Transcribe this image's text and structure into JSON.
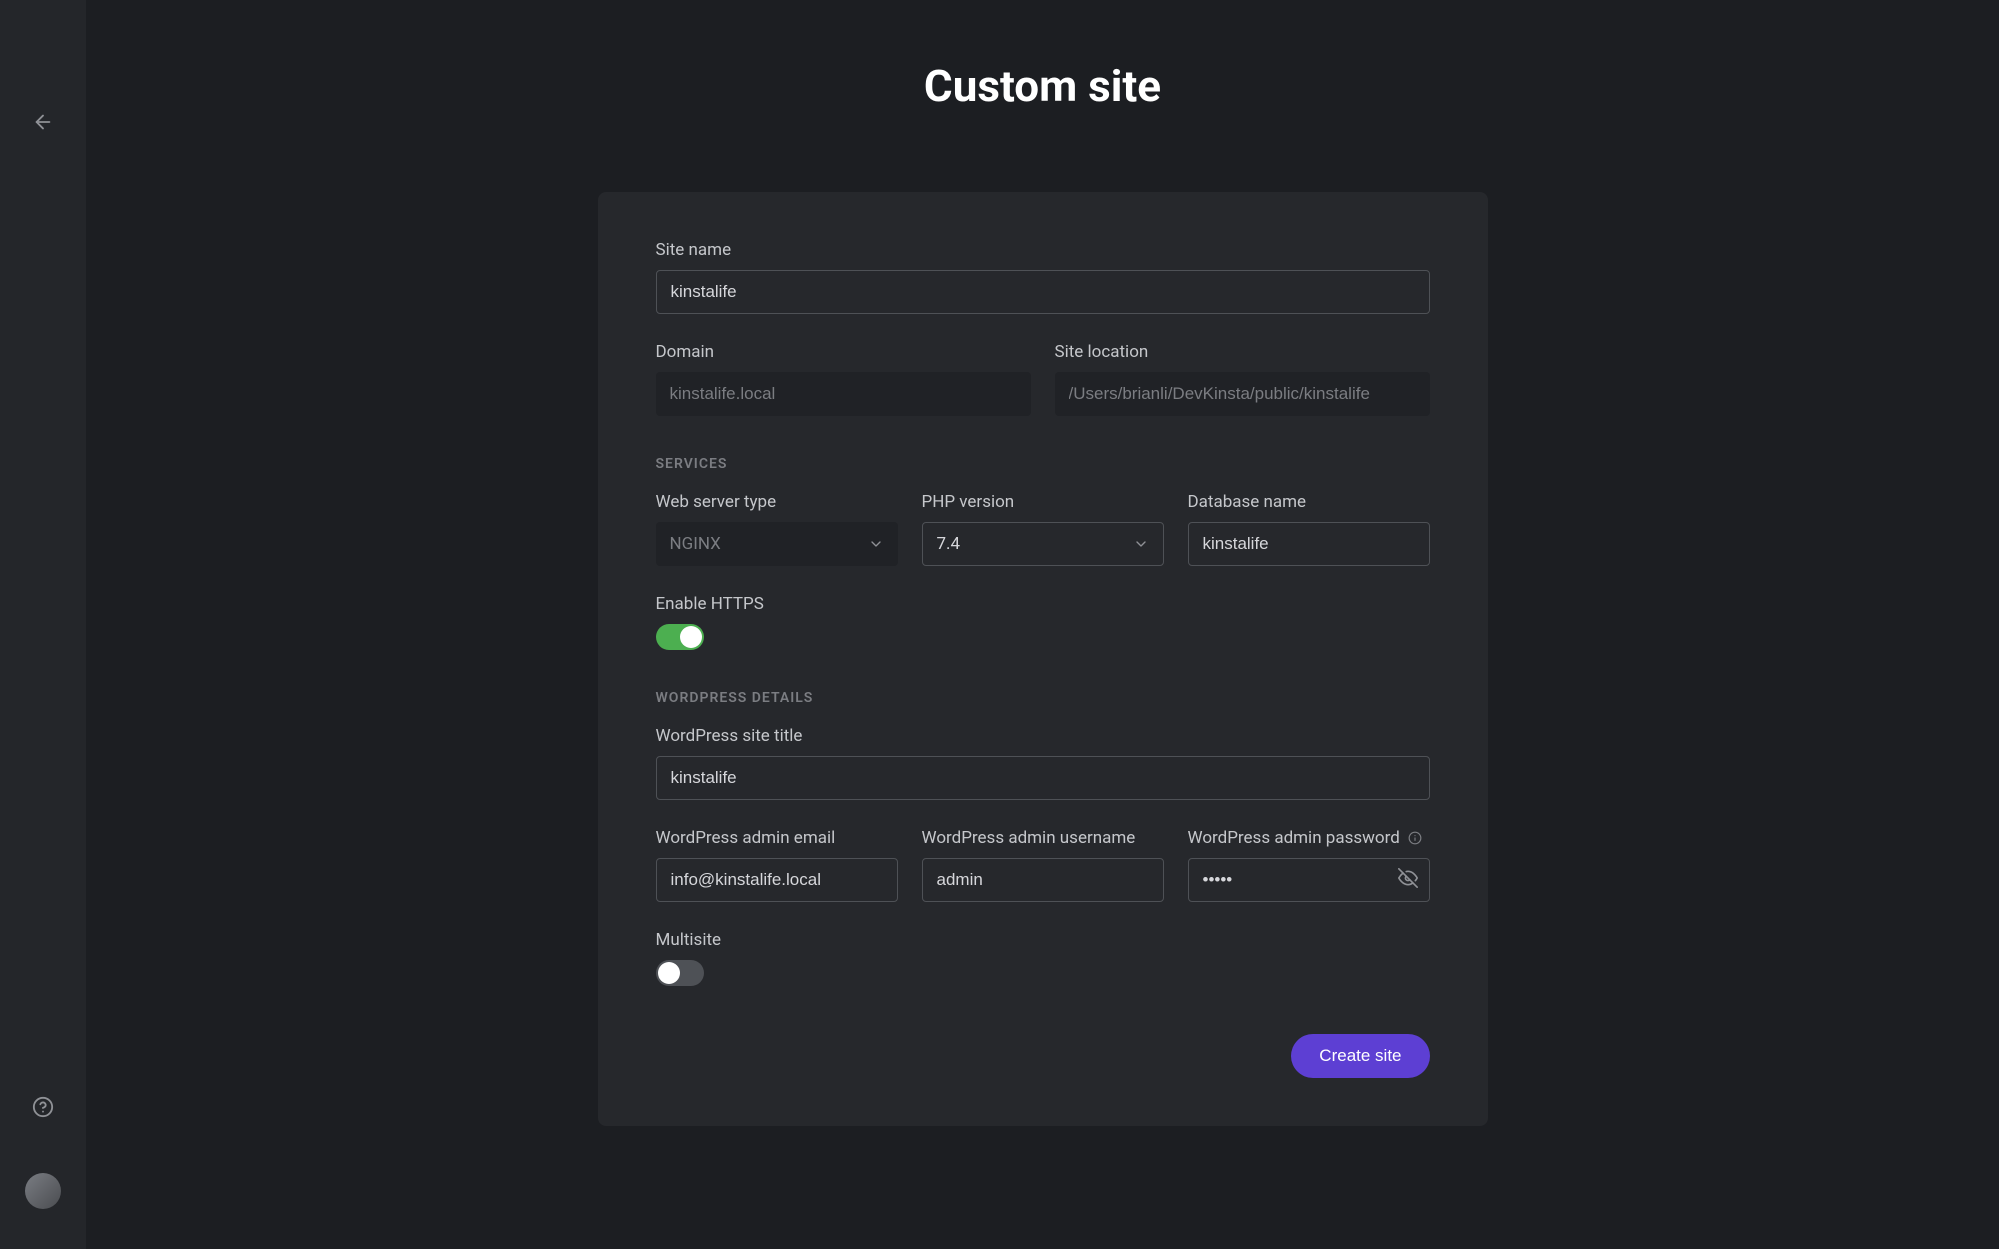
{
  "page": {
    "title": "Custom site"
  },
  "fields": {
    "site_name": {
      "label": "Site name",
      "value": "kinstalife"
    },
    "domain": {
      "label": "Domain",
      "value": "kinstalife.local"
    },
    "site_location": {
      "label": "Site location",
      "value": "/Users/brianli/DevKinsta/public/kinstalife"
    }
  },
  "sections": {
    "services": "SERVICES",
    "wordpress": "WORDPRESS DETAILS"
  },
  "services": {
    "web_server_type": {
      "label": "Web server type",
      "value": "NGINX"
    },
    "php_version": {
      "label": "PHP version",
      "value": "7.4"
    },
    "database_name": {
      "label": "Database name",
      "value": "kinstalife"
    },
    "enable_https": {
      "label": "Enable HTTPS",
      "value": true
    }
  },
  "wordpress": {
    "site_title": {
      "label": "WordPress site title",
      "value": "kinstalife"
    },
    "admin_email": {
      "label": "WordPress admin email",
      "value": "info@kinstalife.local"
    },
    "admin_username": {
      "label": "WordPress admin username",
      "value": "admin"
    },
    "admin_password": {
      "label": "WordPress admin password",
      "value": "•••••"
    },
    "multisite": {
      "label": "Multisite",
      "value": false
    }
  },
  "buttons": {
    "create_site": "Create site"
  }
}
